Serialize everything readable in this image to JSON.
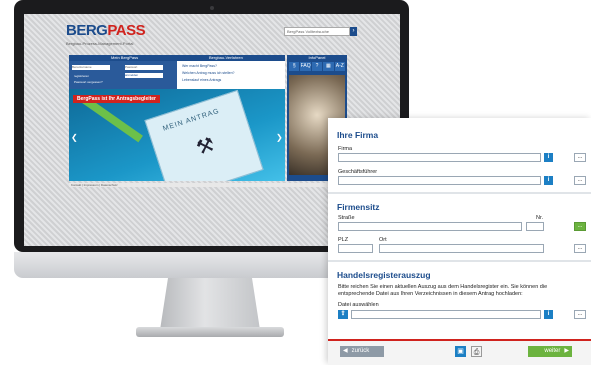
{
  "screen": {
    "logo_main": "BERG",
    "logo_accent": "PASS",
    "logo_sub": "Bergbau-Prozess-Management-Portal",
    "search_placeholder": "BergPass Volltextsuche",
    "nav_left": "Mein BergPass",
    "nav_right": "Bergbau-Verfahren",
    "login_fields": [
      "Benutzername",
      "Passwort"
    ],
    "login_links": [
      "registrieren",
      "Passwort vergessen?"
    ],
    "login_button": "anmelden",
    "quick_links": [
      "Wer macht BergPass?",
      "Welchen Antrag muss ich stellen?",
      "Lebenslauf eines Antrags"
    ],
    "hero_ribbon": "BergPass ist Ihr Antragsbegleiter",
    "hero_paper_title": "MEIN ANTRAG",
    "info_title": "InfoPanel",
    "info_icons": [
      "§",
      "FAQ",
      "?",
      "▦",
      "A-Z"
    ],
    "footer_text": "Kontakt | Impressum | Datenschutz"
  },
  "form": {
    "firma": {
      "title": "Ihre Firma",
      "firma_label": "Firma",
      "gf_label": "Geschäftsführer"
    },
    "sitz": {
      "title": "Firmensitz",
      "strasse_label": "Straße",
      "nr_label": "Nr.",
      "plz_label": "PLZ",
      "ort_label": "Ort"
    },
    "register": {
      "title": "Handelsregisterauszug",
      "text1": "Bitte reichen Sie einen aktuellen Auszug aus dem Handelsregister ein. Sie können die",
      "text2": "entsprechende Datei aus Ihren Verzeichnissen in diesem Antrag hochladen:",
      "file_label": "Datei auswählen"
    },
    "buttons": {
      "info": "i",
      "dots": "...",
      "back": "zurück",
      "next": "weiter"
    }
  }
}
